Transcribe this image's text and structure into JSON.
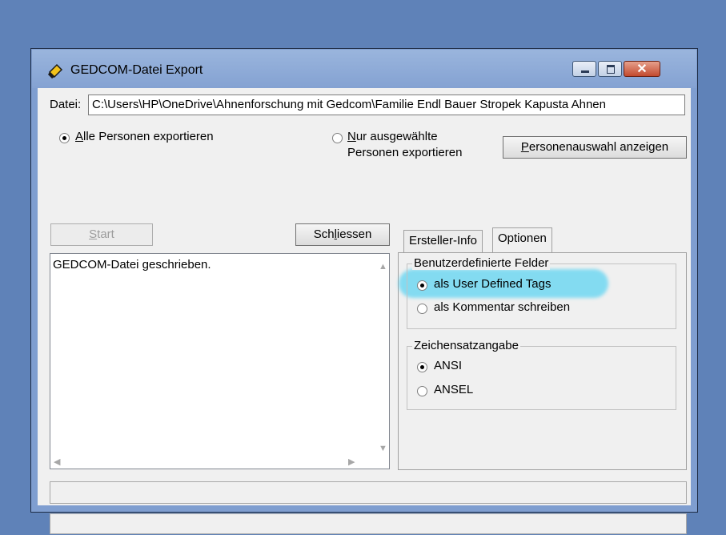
{
  "window": {
    "title": "GEDCOM-Datei Export"
  },
  "path": {
    "label": "Datei:",
    "value": "C:\\Users\\HP\\OneDrive\\Ahnenforschung mit Gedcom\\Familie Endl Bauer Stropek Kapusta Ahnen"
  },
  "export_scope": {
    "all_accel": "A",
    "all_rest": "lle Personen exportieren",
    "all_selected": true,
    "selected_accel": "N",
    "selected_line1_rest": "ur ausgewählte",
    "selected_line2": "Personen exportieren",
    "selected_selected": false
  },
  "buttons": {
    "show_selection_accel": "P",
    "show_selection_rest": "ersonenauswahl anzeigen",
    "start_accel": "S",
    "start_rest": "tart",
    "close_pre": "Sch",
    "close_accel": "l",
    "close_rest": "iessen"
  },
  "log": {
    "text": "GEDCOM-Datei geschrieben."
  },
  "tabs": [
    {
      "label": "Ersteller-Info",
      "active": false
    },
    {
      "label": "Optionen",
      "active": true
    }
  ],
  "options": {
    "custom_fields": {
      "title": "Benutzerdefinierte Felder",
      "opt1": "als User Defined Tags",
      "opt1_selected": true,
      "opt2": "als Kommentar schreiben",
      "opt2_selected": false
    },
    "charset": {
      "title": "Zeichensatzangabe",
      "opt1": "ANSI",
      "opt1_selected": true,
      "opt2": "ANSEL",
      "opt2_selected": false
    }
  },
  "colors": {
    "desktop": "#5f82b8",
    "highlight": "#5fd4f2",
    "close_button": "#c34a2e"
  },
  "icons": {
    "app": "shield-icon",
    "minimize": "minimize-icon",
    "maximize": "maximize-icon",
    "close": "close-icon",
    "scroll_up": "scroll-up-icon",
    "scroll_down": "scroll-down-icon",
    "scroll_left": "scroll-left-icon",
    "scroll_right": "scroll-right-icon"
  }
}
